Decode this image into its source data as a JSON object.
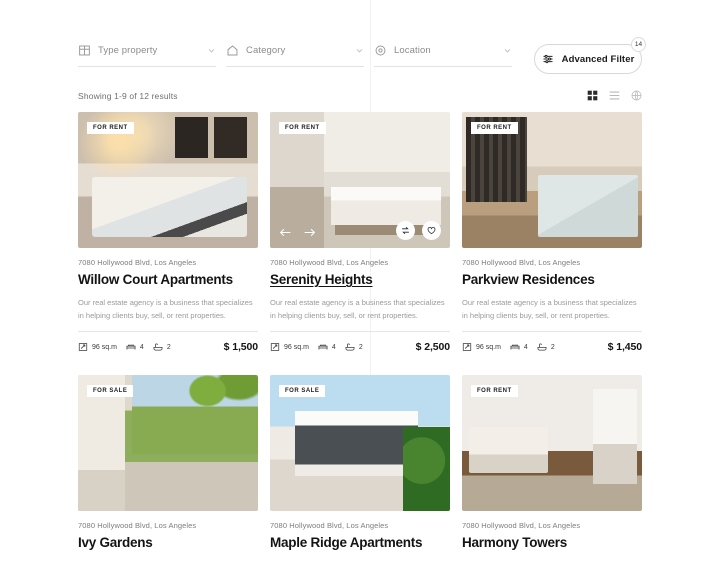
{
  "filters": {
    "fields": [
      {
        "label": "Type property",
        "icon": "building-icon"
      },
      {
        "label": "Category",
        "icon": "home-icon"
      },
      {
        "label": "Location",
        "icon": "location-pin-icon"
      }
    ],
    "advanced": {
      "label": "Advanced Filter",
      "badge": "14",
      "icon": "sliders-icon"
    }
  },
  "results": {
    "text": "Showing 1-9 of 12 results",
    "views": [
      {
        "name": "grid-view",
        "active": true
      },
      {
        "name": "list-view",
        "active": false
      },
      {
        "name": "map-view",
        "active": false
      }
    ]
  },
  "cards": [
    {
      "status": "FOR RENT",
      "address": "7080 Hollywood Blvd, Los Angeles",
      "title": "Willow Court Apartments",
      "underlined": false,
      "description": "Our real estate agency is a business that specializes in helping clients buy, sell, or rent properties.",
      "area": "96 sq.m",
      "beds": "4",
      "baths": "2",
      "price": "$ 1,500",
      "show_overlay": false,
      "photo": "ph-bedroom1"
    },
    {
      "status": "FOR RENT",
      "address": "7080 Hollywood Blvd, Los Angeles",
      "title": "Serenity Heights",
      "underlined": true,
      "description": "Our real estate agency is a business that specializes in helping clients buy, sell, or rent properties.",
      "area": "96 sq.m",
      "beds": "4",
      "baths": "2",
      "price": "$ 2,500",
      "show_overlay": true,
      "photo": "ph-kitchen"
    },
    {
      "status": "FOR RENT",
      "address": "7080 Hollywood Blvd, Los Angeles",
      "title": "Parkview Residences",
      "underlined": false,
      "description": "Our real estate agency is a business that specializes in helping clients buy, sell, or rent properties.",
      "area": "96 sq.m",
      "beds": "4",
      "baths": "2",
      "price": "$ 1,450",
      "show_overlay": false,
      "photo": "ph-bedroom2"
    },
    {
      "status": "FOR SALE",
      "address": "7080 Hollywood Blvd, Los Angeles",
      "title": "Ivy Gardens",
      "underlined": false,
      "description": "",
      "area": "",
      "beds": "",
      "baths": "",
      "price": "",
      "show_overlay": false,
      "photo": "ph-villa"
    },
    {
      "status": "FOR SALE",
      "address": "7080 Hollywood Blvd, Los Angeles",
      "title": "Maple Ridge Apartments",
      "underlined": false,
      "description": "",
      "area": "",
      "beds": "",
      "baths": "",
      "price": "",
      "show_overlay": false,
      "photo": "ph-modern"
    },
    {
      "status": "FOR RENT",
      "address": "7080 Hollywood Blvd, Los Angeles",
      "title": "Harmony Towers",
      "underlined": false,
      "description": "",
      "area": "",
      "beds": "",
      "baths": "",
      "price": "",
      "show_overlay": false,
      "photo": "ph-living"
    }
  ],
  "colors": {
    "text_primary": "#141414",
    "text_muted": "#9a9a9a",
    "border": "#e6e6e6",
    "badge_bg": "#ffffff"
  }
}
